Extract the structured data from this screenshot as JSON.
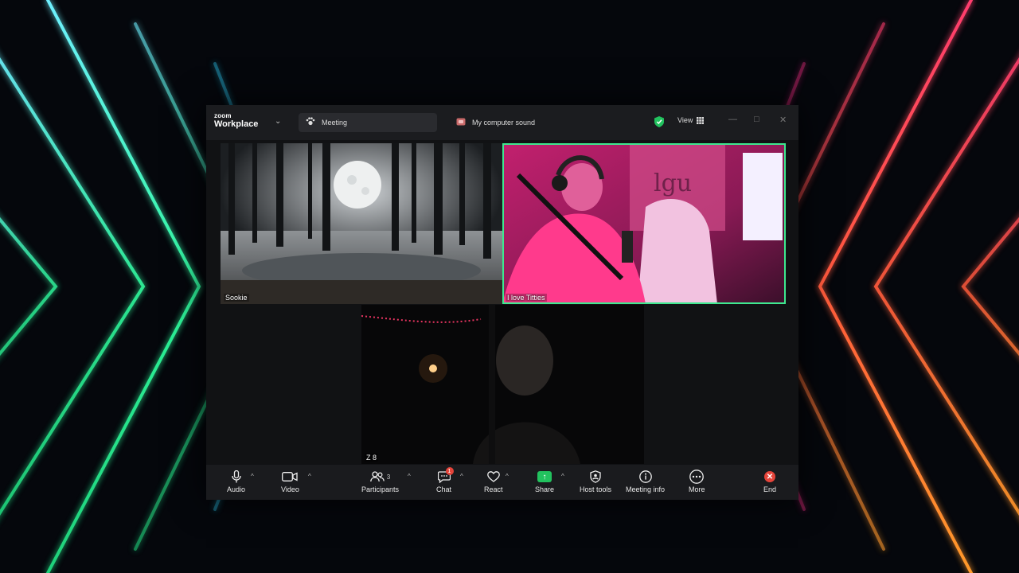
{
  "app": {
    "brand_small": "zoom",
    "brand_big": "Workplace"
  },
  "tabs": {
    "meeting": "Meeting",
    "sound": "My computer sound"
  },
  "header": {
    "view_label": "View"
  },
  "participants": [
    {
      "name": "Sookie"
    },
    {
      "name": "I love Titties"
    },
    {
      "name": "Z 8"
    }
  ],
  "toolbar": {
    "audio": "Audio",
    "video": "Video",
    "participants": "Participants",
    "participants_count": "3",
    "chat": "Chat",
    "chat_badge": "1",
    "react": "React",
    "share": "Share",
    "host_tools": "Host tools",
    "meeting_info": "Meeting info",
    "more": "More",
    "end": "End"
  },
  "colors": {
    "active_speaker": "#3ee88f",
    "share_green": "#22c25e",
    "end_red": "#e5443a",
    "neon_green": "#32f5a0",
    "neon_red": "#ff2d55",
    "neon_orange": "#ff8a2a"
  },
  "icons": {
    "audio": "microphone-icon",
    "video": "video-camera-icon",
    "participants": "people-icon",
    "chat": "chat-bubble-icon",
    "react": "heart-icon",
    "share": "share-up-arrow-icon",
    "host_tools": "shield-icon",
    "meeting_info": "info-icon",
    "more": "ellipsis-icon",
    "end": "close-x-icon"
  }
}
